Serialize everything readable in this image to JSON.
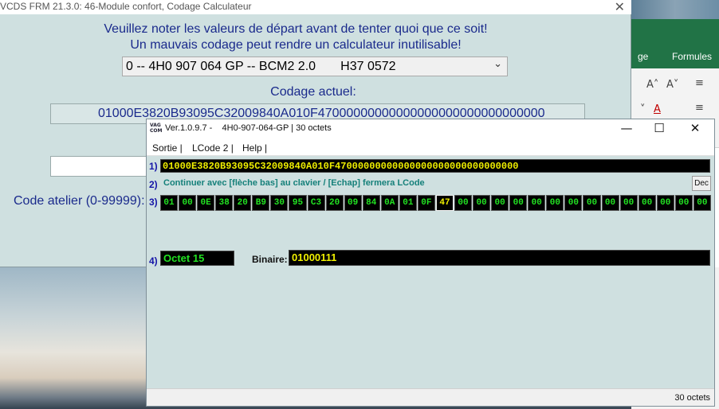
{
  "main_window": {
    "title": "VCDS FRM 21.3.0: 46-Module confort,  Codage Calculateur",
    "close_glyph": "✕",
    "warning_line1": "Veuillez noter les valeurs de départ avant de tenter quoi que ce soit!",
    "warning_line2": "Un mauvais codage peut rendre un calculateur inutilisable!",
    "coding_select": "0 -- 4H0 907 064 GP -- BCM2 2.0       H37 0572",
    "select_arrow": "⌄",
    "current_coding_label": "Codage actuel:",
    "current_coding_value": "01000E3820B93095C32009840A010F47000000000000000000000000000000",
    "atelier_label": "Code atelier (0-99999):"
  },
  "excel": {
    "tab_partial": "ge",
    "tab_formulas": "Formules",
    "glyph_font_grow": "A˄",
    "glyph_font_shrink": "A˅",
    "glyph_font_color": "A",
    "glyph_align": "≡",
    "glyph_more": "˅"
  },
  "lcode": {
    "logo_text": "VAG\nCOM",
    "title": "Ver.1.0.9.7 -    4H0-907-064-GP | 30 octets",
    "btn_minimize": "—",
    "btn_maximize": "☐",
    "btn_close": "✕",
    "menu": [
      "Sortie |",
      "LCode 2 |",
      "Help |"
    ],
    "row1_num": "1)",
    "row1_value": "01000E3820B93095C32009840A010F47000000000000000000000000000000",
    "row2_num": "2)",
    "instruction": "Continuer avec [flèche bas] au clavier / [Echap] fermera LCode",
    "dec_button": "Dec",
    "row3_num": "3)",
    "bytes": [
      "01",
      "00",
      "0E",
      "38",
      "20",
      "B9",
      "30",
      "95",
      "C3",
      "20",
      "09",
      "84",
      "0A",
      "01",
      "0F",
      "47",
      "00",
      "00",
      "00",
      "00",
      "00",
      "00",
      "00",
      "00",
      "00",
      "00",
      "00",
      "00",
      "00",
      "00"
    ],
    "selected_byte_index": 15,
    "row4_num": "4)",
    "octet_label": "Octet 15",
    "binaire_label": "Binaire:",
    "binaire_value": "01000111",
    "status_text": "30 octets"
  },
  "colors": {
    "window_bg": "#cfe0e0",
    "label_blue": "#1a2a8c",
    "hex_yellow": "#f0f000",
    "hex_green": "#22e222",
    "instruction_teal": "#15807a",
    "excel_green": "#217346"
  }
}
